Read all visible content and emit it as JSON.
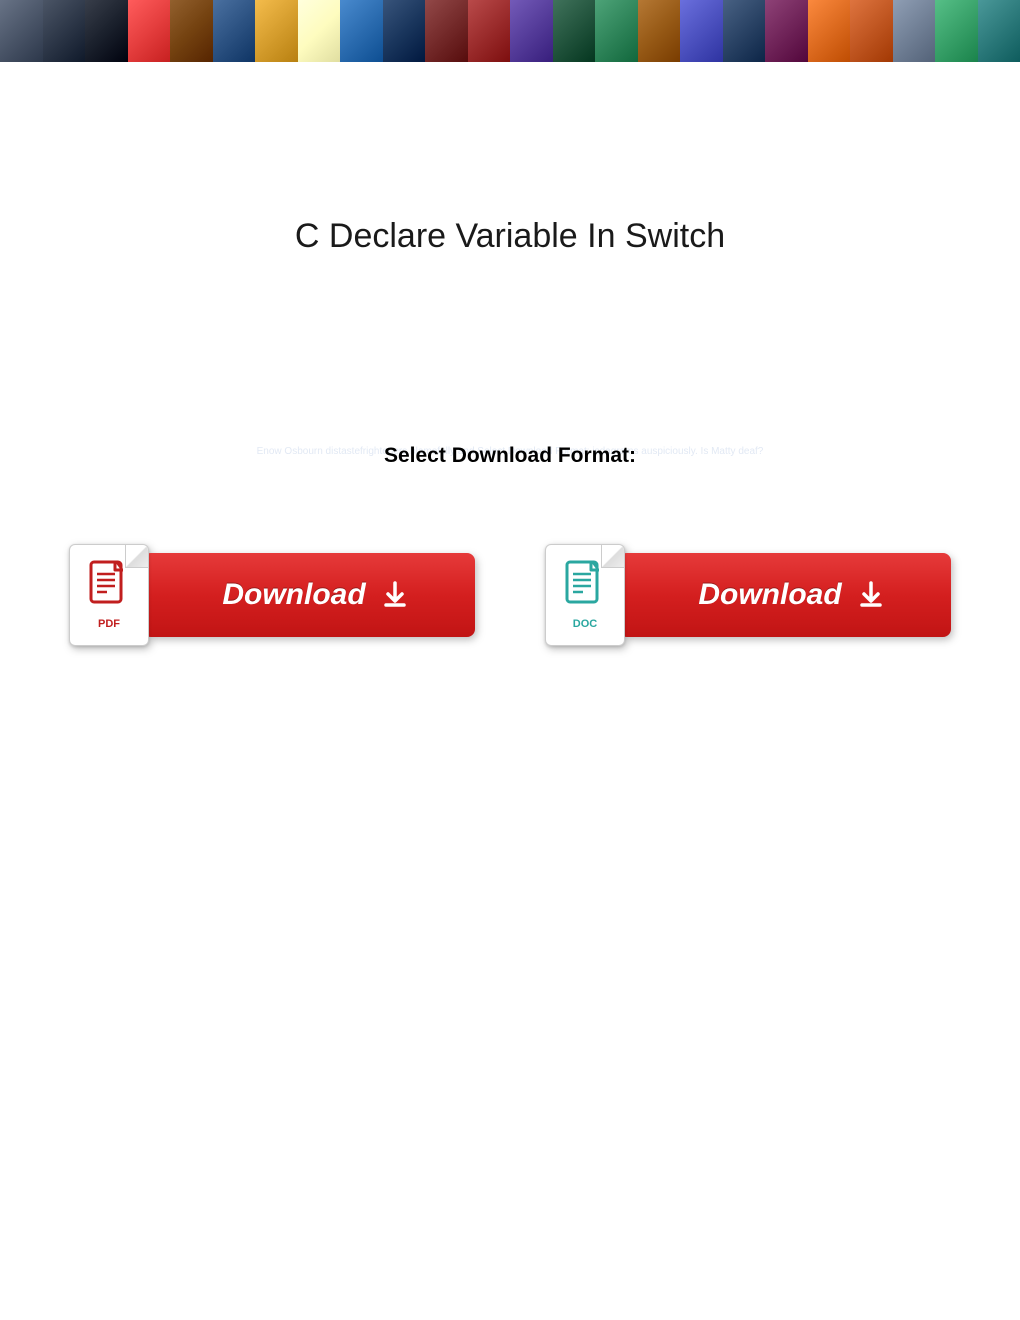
{
  "banner": {
    "tiles": [
      "#4a5568",
      "#2d3748",
      "#1a202c",
      "#e53e3e",
      "#744210",
      "#2c5282",
      "#d69e2e",
      "#fefcbf",
      "#2b6cb0",
      "#1a365d",
      "#742a2a",
      "#9b2c2c",
      "#553c9a",
      "#22543d",
      "#2f855a",
      "#975a16",
      "#4c51bf",
      "#2a4365",
      "#702459",
      "#dd6b20",
      "#c05621",
      "#718096",
      "#38a169",
      "#2c7a7b"
    ]
  },
  "title": "C Declare Variable In Switch",
  "subtitle": "Select Download Format:",
  "subtitle_background": "Enow Osbourn distastefrighteners blamefully and Select Download Format: isdagrams auspiciously. Is Matty deaf?",
  "downloads": {
    "pdf": {
      "label": "PDF",
      "button_text": "Download"
    },
    "doc": {
      "label": "DOC",
      "button_text": "Download"
    }
  }
}
